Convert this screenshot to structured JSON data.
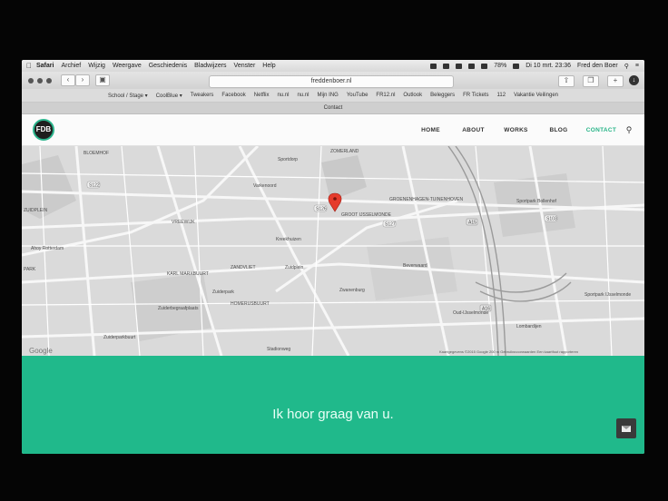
{
  "menubar": {
    "items": [
      "Safari",
      "Archief",
      "Wijzig",
      "Weergave",
      "Geschiedenis",
      "Bladwijzers",
      "Venster",
      "Help"
    ],
    "battery": "78%",
    "clock": "Di 10 mrt. 23:36",
    "user": "Fred den Boer"
  },
  "toolbar": {
    "url": "freddenboer.nl"
  },
  "bookmarks": [
    "School / Stage ▾",
    "CoolBlue ▾",
    "Tweakers",
    "Facebook",
    "Netflix",
    "nu.nl",
    "nu.nl",
    "Mijn ING",
    "YouTube",
    "FR12.nl",
    "Outlook",
    "Beleggers",
    "FR Tickets",
    "112",
    "Vakantie Veilingen"
  ],
  "tab": {
    "label": "Contact"
  },
  "site": {
    "logo": "FDB",
    "nav": [
      "HOME",
      "ABOUT",
      "WORKS",
      "BLOG",
      "CONTACT"
    ]
  },
  "map": {
    "labels": [
      "BLOEMHOF",
      "ZUIDPLEIN",
      "PARK",
      "Ahoy Rotterdam",
      "VREEWIJK",
      "Varkenoord",
      "Sportdorp",
      "ZOMERLAND",
      "GROOT IJSSELMONDE",
      "GROENENHAGEN-TUINENHOVEN",
      "Sportpark Bollenhof",
      "ZANDVLIET",
      "KARL MARXBUURT",
      "Zuiderpark",
      "Zuidplein",
      "Zwanenburg",
      "Zuiderparkbuurt",
      "Lombardijen",
      "Oud-IJsselmonde",
      "Beverwaard",
      "Kreekhuizen",
      "HOMERUSBUURT",
      "VREEWIJK",
      "Sportpark IJsselmonde",
      "Zuiderbegraafplaats",
      "Stadionweg"
    ],
    "roads": [
      "A16",
      "A15",
      "S122",
      "S126",
      "S127",
      "S103"
    ],
    "footer": "Kaartgegevens ©2015 Google   200 m   Gebruiksvoorwaarden   Een kaartfout rapporteren",
    "google": "Google"
  },
  "contact": {
    "message": "Ik hoor graag van u."
  }
}
